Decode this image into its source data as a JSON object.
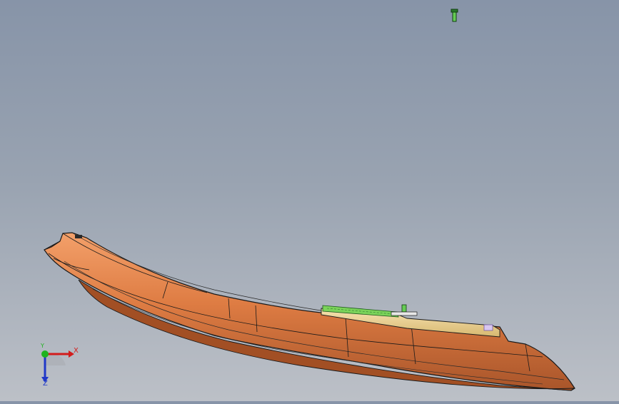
{
  "viewport": {
    "background_top": "#8794a8",
    "background_bottom": "#bcc0c7",
    "part_color": "#d9773f",
    "part_shadow": "#a9552a",
    "edge_color": "#1a1a1a",
    "sub_component_color": "#6fcc4a",
    "rail_color": "#f0d79a"
  },
  "triad": {
    "x_label": "X",
    "y_label": "Y",
    "z_label": "Z",
    "x_color": "#d21c1c",
    "y_color": "#1fb31f",
    "z_color": "#2038c8"
  },
  "icons": {
    "floating_part": "screw-clip-icon",
    "triad": "axis-triad-icon"
  }
}
